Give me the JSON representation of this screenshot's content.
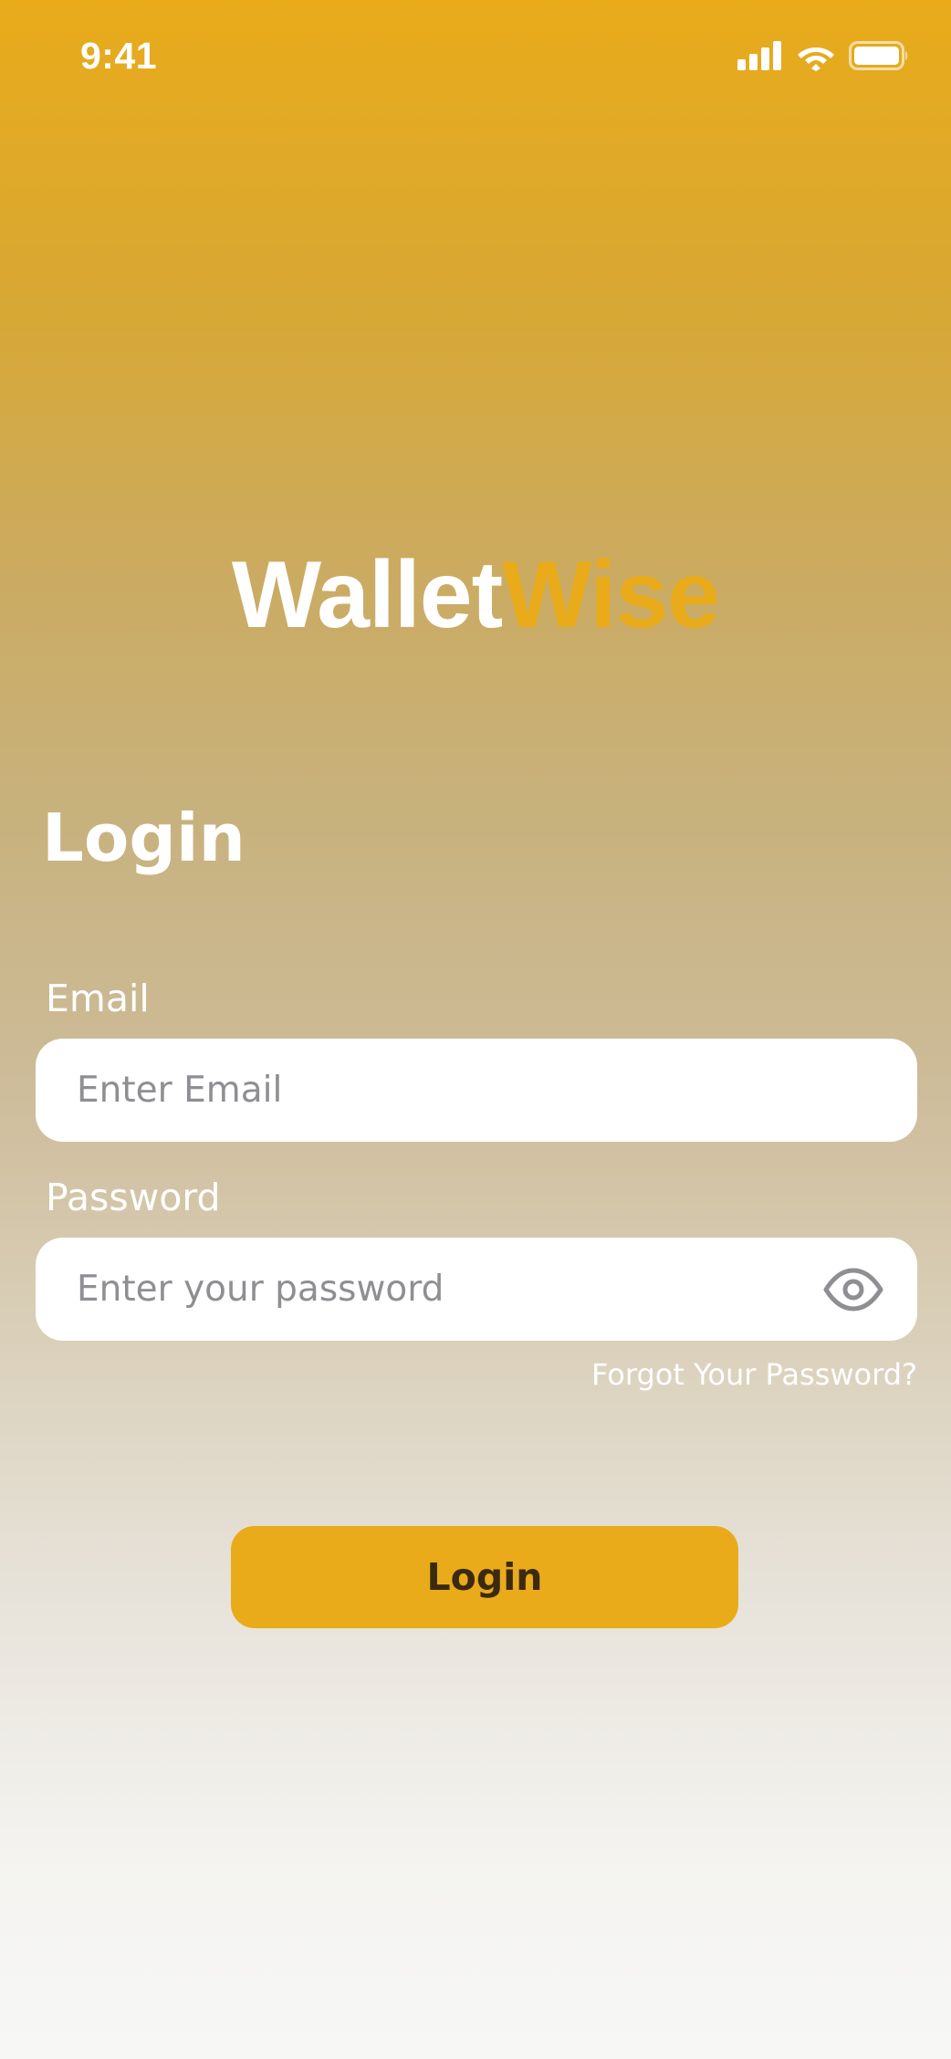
{
  "status_bar": {
    "time": "9:41",
    "icons": [
      "cellular-signal-icon",
      "wifi-icon",
      "battery-icon"
    ]
  },
  "logo": {
    "part_a": "Wallet",
    "part_b": "Wise",
    "colors": {
      "part_a": "#ffffff",
      "part_b": "#e9ab1a"
    }
  },
  "login": {
    "title": "Login",
    "email": {
      "label": "Email",
      "placeholder": "Enter Email",
      "value": ""
    },
    "password": {
      "label": "Password",
      "placeholder": "Enter your password",
      "value": "",
      "toggle_icon": "eye-icon"
    },
    "forgot_password": "Forgot Your Password?",
    "submit_label": "Login"
  },
  "theme": {
    "accent": "#e9ab1a",
    "button_text": "#3b2a10",
    "background_top": "#e9ab1a",
    "background_bottom": "#f7f7f6"
  }
}
